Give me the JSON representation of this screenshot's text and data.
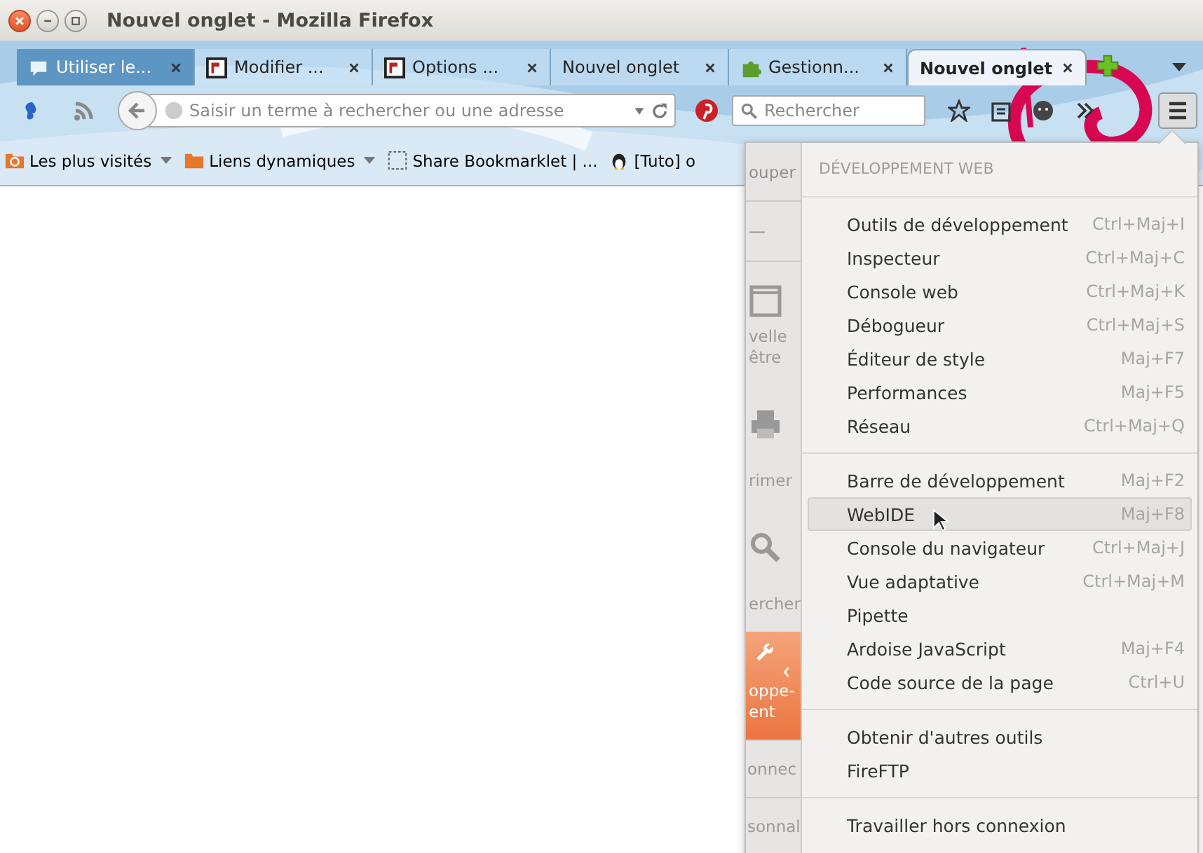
{
  "window": {
    "title": "Nouvel onglet - Mozilla Firefox"
  },
  "tabs": [
    {
      "label": "Utiliser le...",
      "kind": "chat",
      "selected": false,
      "pending": true
    },
    {
      "label": "Modifier ...",
      "kind": "frame",
      "selected": false,
      "pending": false
    },
    {
      "label": "Options ...",
      "kind": "frame",
      "selected": false,
      "pending": false
    },
    {
      "label": "Nouvel onglet",
      "kind": "plain",
      "selected": false,
      "pending": false
    },
    {
      "label": "Gestionn...",
      "kind": "puzzle",
      "selected": false,
      "pending": false
    },
    {
      "label": "Nouvel onglet",
      "kind": "plain",
      "selected": true,
      "pending": false
    }
  ],
  "navbar": {
    "url_placeholder": "Saisir un terme à rechercher ou une adresse",
    "search_placeholder": "Rechercher"
  },
  "bookmarks": [
    {
      "label": "Les plus visités",
      "kind": "smart",
      "dropdown": true
    },
    {
      "label": "Liens dynamiques",
      "kind": "folder",
      "dropdown": true
    },
    {
      "label": "Share Bookmarklet | ...",
      "kind": "blank",
      "dropdown": false
    },
    {
      "label": "[Tuto] o",
      "kind": "tux",
      "dropdown": false
    }
  ],
  "main_menu": {
    "cut_label": "ouper",
    "zoom_label": "—",
    "buttons": [
      {
        "kind": "window",
        "lines": [
          "velle",
          "être"
        ],
        "selected": false
      },
      {
        "kind": "printer",
        "lines": [
          "rimer"
        ],
        "selected": false
      },
      {
        "kind": "search",
        "lines": [
          "ercher"
        ],
        "selected": false
      },
      {
        "kind": "wrench",
        "lines": [
          "oppe-",
          "ent"
        ],
        "selected": true
      }
    ],
    "footer": [
      "onnec",
      "sonnal"
    ]
  },
  "panel": {
    "heading": "DÉVELOPPEMENT WEB",
    "sections": [
      [
        {
          "label": "Outils de développement",
          "shortcut": "Ctrl+Maj+I",
          "hovered": false
        },
        {
          "label": "Inspecteur",
          "shortcut": "Ctrl+Maj+C",
          "hovered": false
        },
        {
          "label": "Console web",
          "shortcut": "Ctrl+Maj+K",
          "hovered": false
        },
        {
          "label": "Débogueur",
          "shortcut": "Ctrl+Maj+S",
          "hovered": false
        },
        {
          "label": "Éditeur de style",
          "shortcut": "Maj+F7",
          "hovered": false
        },
        {
          "label": "Performances",
          "shortcut": "Maj+F5",
          "hovered": false
        },
        {
          "label": "Réseau",
          "shortcut": "Ctrl+Maj+Q",
          "hovered": false
        }
      ],
      [
        {
          "label": "Barre de développement",
          "shortcut": "Maj+F2",
          "hovered": false
        },
        {
          "label": "WebIDE",
          "shortcut": "Maj+F8",
          "hovered": true
        },
        {
          "label": "Console du navigateur",
          "shortcut": "Ctrl+Maj+J",
          "hovered": false
        },
        {
          "label": "Vue adaptative",
          "shortcut": "Ctrl+Maj+M",
          "hovered": false
        },
        {
          "label": "Pipette",
          "hovered": false
        },
        {
          "label": "Ardoise JavaScript",
          "shortcut": "Maj+F4",
          "hovered": false
        },
        {
          "label": "Code source de la page",
          "shortcut": "Ctrl+U",
          "hovered": false
        }
      ],
      [
        {
          "label": "Obtenir d'autres outils",
          "hovered": false
        },
        {
          "label": "FireFTP",
          "hovered": false
        }
      ],
      [
        {
          "label": "Travailler hors connexion",
          "hovered": false
        }
      ]
    ]
  }
}
